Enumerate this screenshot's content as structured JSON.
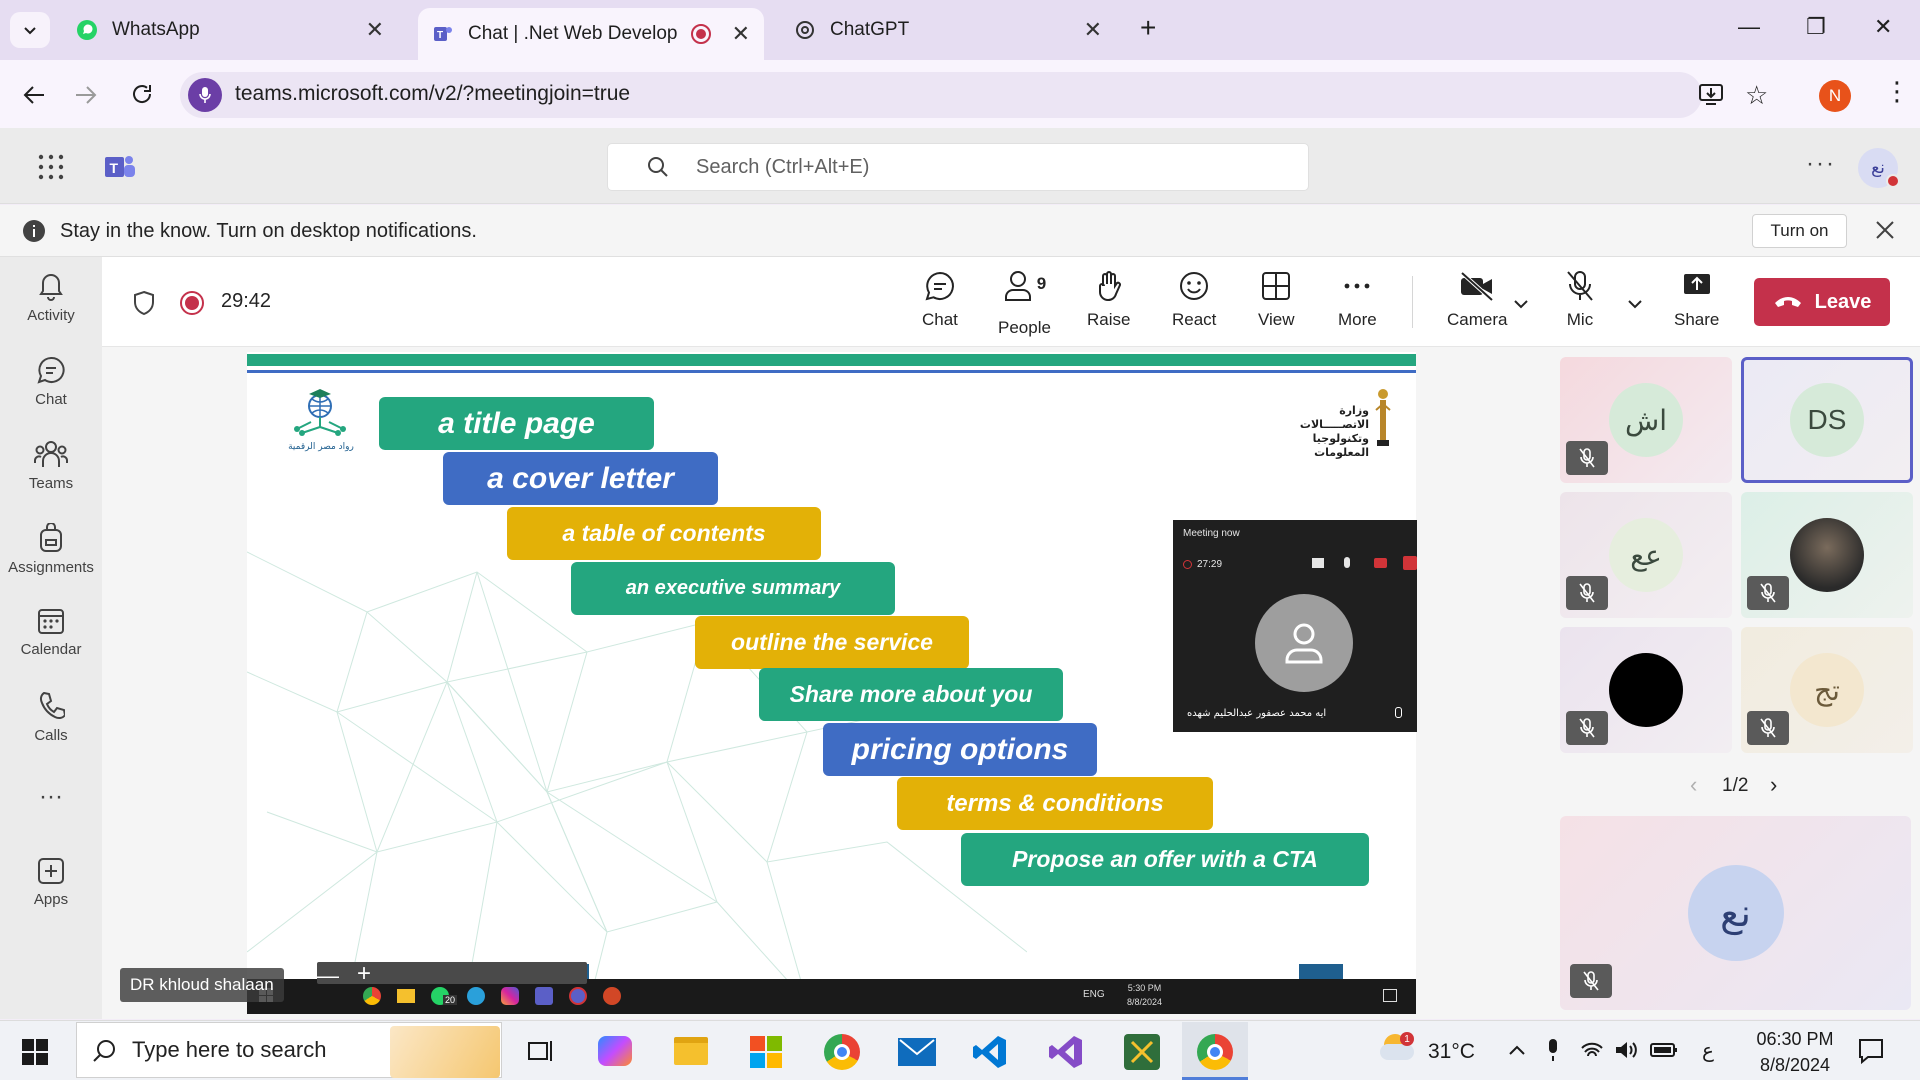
{
  "browser": {
    "tabs": [
      {
        "title": "WhatsApp",
        "icon": "whatsapp-icon"
      },
      {
        "title": "Chat | .Net Web Developer (",
        "icon": "teams-icon",
        "active": true
      },
      {
        "title": "ChatGPT",
        "icon": "chatgpt-icon"
      }
    ],
    "url": "teams.microsoft.com/v2/?meetingjoin=true",
    "profile_initial": "N"
  },
  "teams": {
    "search_placeholder": "Search (Ctrl+Alt+E)",
    "user_initials": "نع",
    "notification": {
      "text": "Stay in the know. Turn on desktop notifications.",
      "button": "Turn on"
    },
    "rail": [
      {
        "label": "Activity",
        "icon": "bell-icon"
      },
      {
        "label": "Chat",
        "icon": "chat-icon"
      },
      {
        "label": "Teams",
        "icon": "teams-group-icon"
      },
      {
        "label": "Assignments",
        "icon": "backpack-icon"
      },
      {
        "label": "Calendar",
        "icon": "calendar-icon"
      },
      {
        "label": "Calls",
        "icon": "phone-icon"
      },
      {
        "label": "...",
        "icon": "more-icon"
      },
      {
        "label": "Apps",
        "icon": "add-apps-icon"
      }
    ]
  },
  "meeting": {
    "elapsed": "29:42",
    "controls": {
      "chat": "Chat",
      "people": "People",
      "people_count": "9",
      "raise": "Raise",
      "react": "React",
      "view": "View",
      "more": "More",
      "camera": "Camera",
      "mic": "Mic",
      "share": "Share",
      "leave": "Leave"
    },
    "slide": {
      "bars": [
        {
          "text": "a title page",
          "color": "green"
        },
        {
          "text": "a cover letter",
          "color": "blue"
        },
        {
          "text": "a table of contents",
          "color": "gold"
        },
        {
          "text": "an executive summary",
          "color": "green"
        },
        {
          "text": "outline the service",
          "color": "gold"
        },
        {
          "text": "Share more about you",
          "color": "green"
        },
        {
          "text": "pricing options",
          "color": "blue"
        },
        {
          "text": "terms & conditions",
          "color": "gold"
        },
        {
          "text": "Propose an offer with a CTA",
          "color": "green"
        }
      ],
      "logo_left_caption": "رواد مصر الرقمية",
      "logo_right_line1": "وزارة الاتصـــــالات",
      "logo_right_line2": "وتكنولوجيا المعلومات",
      "mini_window": {
        "title": "Meeting now",
        "timer": "27:29",
        "participant_name": "ايه محمد عصفور عبدالحليم شهده"
      },
      "inner_taskbar": {
        "time": "5:30 PM",
        "date": "8/8/2024",
        "lang": "ENG",
        "whatsapp_badge": "20"
      }
    },
    "presenter_name": "DR khloud shalaan",
    "participants": [
      {
        "initials": "اش",
        "bg": "#f5d9de",
        "avatar_bg": "#d6ead9",
        "muted": true
      },
      {
        "initials": "DS",
        "bg": "#e8e7f2",
        "avatar_bg": "#d6ead9",
        "muted": false,
        "selected": true
      },
      {
        "initials": "عع",
        "bg": "#ede4ea",
        "avatar_bg": "#e6eede",
        "muted": true
      },
      {
        "initials": "",
        "bg": "#dcefe7",
        "avatar_bg": "#2a2a2a",
        "muted": true,
        "photo": true
      },
      {
        "initials": "",
        "bg": "#ebe3ee",
        "avatar_bg": "#000000",
        "muted": true
      },
      {
        "initials": "تج",
        "bg": "#f1ecdf",
        "avatar_bg": "#f3e7cf",
        "muted": true
      }
    ],
    "pager": "1/2",
    "self_tile": {
      "initials": "نع"
    }
  },
  "windows": {
    "search_placeholder": "Type here to search",
    "weather": "31°C",
    "weather_badge": "1",
    "ime": "ع",
    "time": "06:30 PM",
    "date": "8/8/2024"
  },
  "colors": {
    "teams_purple": "#5b5fc7",
    "leave_red": "#c4314b",
    "slide_green": "#24a67f",
    "slide_blue": "#3f6cc4",
    "slide_gold": "#e3b107"
  }
}
